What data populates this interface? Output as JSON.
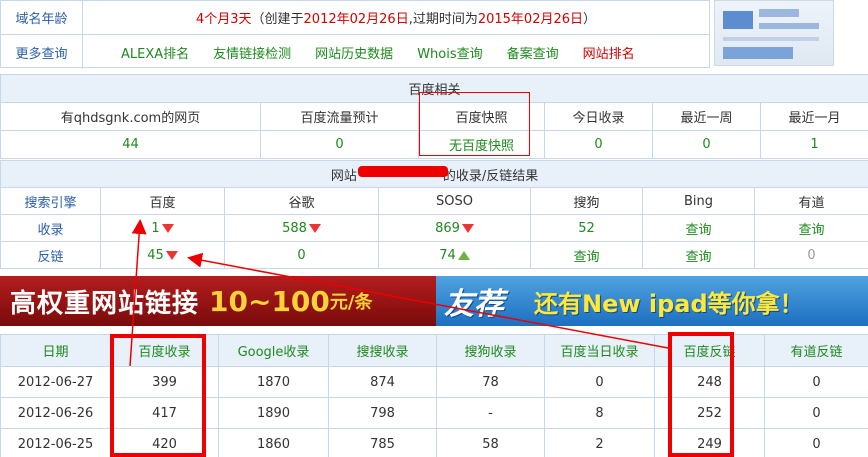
{
  "top": {
    "age_label": "域名年龄",
    "age_value": "4个月3天",
    "age_detail_1": "（创建于",
    "age_created": "2012年02月26日",
    "age_detail_2": ",过期时间为",
    "age_expire": "2015年02月26日",
    "age_detail_3": "）",
    "more_label": "更多查询",
    "links": [
      "ALEXA排名",
      "友情链接检测",
      "网站历史数据",
      "Whois查询",
      "备案查询",
      "网站排名"
    ]
  },
  "baidu": {
    "title": "百度相关",
    "headers": [
      "有qhdsgnk.com的网页",
      "百度流量预计",
      "百度快照",
      "今日收录",
      "最近一周",
      "最近一月"
    ],
    "values": [
      "44",
      "0",
      "无百度快照",
      "0",
      "0",
      "1"
    ]
  },
  "shoulu": {
    "title_prefix": "网站",
    "title_suffix": "的收录/反链结果",
    "headers": [
      "搜索引擎",
      "百度",
      "谷歌",
      "SOSO",
      "搜狗",
      "Bing",
      "有道"
    ],
    "rows": [
      {
        "label": "收录",
        "values": [
          "1",
          "588",
          "869",
          "52",
          "查询",
          "查询"
        ]
      },
      {
        "label": "反链",
        "values": [
          "45",
          "0",
          "74",
          "查询",
          "查询",
          "0"
        ]
      }
    ]
  },
  "banner": {
    "left_text": "高权重网站链接",
    "left_num": "10~100",
    "left_unit": "元/条",
    "right_rec": "友荐",
    "right_promo": "还有New ipad等你拿！"
  },
  "history": {
    "headers": [
      "日期",
      "百度收录",
      "Google收录",
      "搜搜收录",
      "搜狗收录",
      "百度当日收录",
      "百度反链",
      "有道反链"
    ],
    "rows": [
      [
        "2012-06-27",
        "399",
        "1870",
        "874",
        "78",
        "0",
        "248",
        "0"
      ],
      [
        "2012-06-26",
        "417",
        "1890",
        "798",
        "-",
        "8",
        "252",
        "0"
      ],
      [
        "2012-06-25",
        "420",
        "1860",
        "785",
        "58",
        "2",
        "249",
        "0"
      ]
    ]
  },
  "colors": {
    "accent_green": "#1e8a1e",
    "accent_blue": "#2a5ea8",
    "annotation_red": "#e00000",
    "header_bg": "#e8f0fa"
  }
}
